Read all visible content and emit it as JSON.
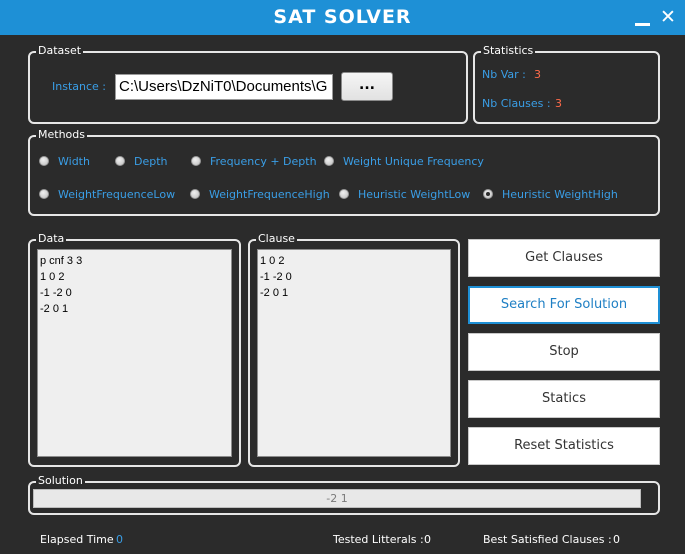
{
  "window": {
    "title": "SAT SOLVER",
    "minimize_glyph": "—",
    "close_glyph": "✕"
  },
  "dataset": {
    "legend": "Dataset",
    "instance_label": "Instance :",
    "instance_value": "C:\\Users\\DzNiT0\\Documents\\G",
    "browse_label": "..."
  },
  "statistics": {
    "legend": "Statistics",
    "nb_var_label": "Nb Var :",
    "nb_var_value": "3",
    "nb_clauses_label": "Nb Clauses :",
    "nb_clauses_value": "3"
  },
  "methods": {
    "legend": "Methods",
    "options": [
      {
        "label": "Width",
        "checked": false
      },
      {
        "label": "Depth",
        "checked": false
      },
      {
        "label": "Frequency + Depth",
        "checked": false
      },
      {
        "label": "Weight Unique Frequency",
        "checked": false
      },
      {
        "label": "WeightFrequenceLow",
        "checked": false
      },
      {
        "label": "WeightFrequenceHigh",
        "checked": false
      },
      {
        "label": "Heuristic WeightLow",
        "checked": false
      },
      {
        "label": "Heuristic WeightHigh",
        "checked": true
      }
    ]
  },
  "data_panel": {
    "legend": "Data",
    "lines": [
      "p cnf 3 3",
      "1 0 2",
      "-1 -2 0",
      "-2 0 1"
    ]
  },
  "clause_panel": {
    "legend": "Clause",
    "lines": [
      "1 0 2",
      "-1 -2 0",
      "-2 0 1"
    ]
  },
  "actions": {
    "get_clauses": "Get Clauses",
    "search": "Search For Solution",
    "stop": "Stop",
    "statics": "Statics",
    "reset": "Reset Statistics"
  },
  "solution": {
    "legend": "Solution",
    "value": "-2 1"
  },
  "status": {
    "elapsed_label": "Elapsed Time",
    "elapsed_value": "0",
    "tested_label": "Tested Litterals :",
    "tested_value": "0",
    "best_label": "Best Satisfied Clauses :",
    "best_value": "0"
  },
  "colors": {
    "accent": "#1e90d6",
    "label_blue": "#3a9ee6",
    "value_red": "#ff6b4a",
    "background": "#2b2b2b"
  }
}
